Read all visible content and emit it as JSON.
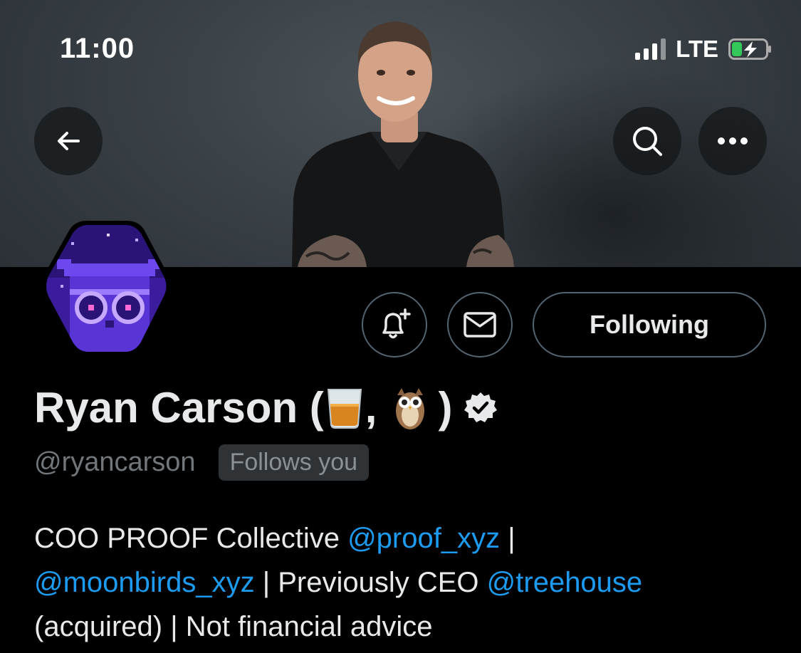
{
  "status_bar": {
    "time": "11:00",
    "network": "LTE"
  },
  "header": {
    "back_icon": "arrow-left-icon",
    "search_icon": "search-icon",
    "more_icon": "more-horizontal-icon"
  },
  "actions": {
    "notify_icon": "bell-plus-icon",
    "message_icon": "envelope-icon",
    "following_label": "Following"
  },
  "profile": {
    "name_prefix": "Ryan Carson (",
    "name_separator": ",",
    "name_suffix": ")",
    "name_emoji": [
      "whisky-glass-emoji",
      "owl-emoji"
    ],
    "verified_icon": "verified-badge-icon",
    "handle": "@ryancarson",
    "follows_you": "Follows you"
  },
  "bio": {
    "line1_text": "COO PROOF Collective ",
    "line1_mention": "@proof_xyz",
    "line1_end": " |",
    "line2_mention": "@moonbirds_xyz",
    "line2_text": " | Previously CEO ",
    "line2_mention2": "@treehouse",
    "line3_text": "(acquired) | Not financial advice"
  },
  "colors": {
    "accent": "#1d9bf0",
    "background": "#000000",
    "muted": "#71767b"
  }
}
